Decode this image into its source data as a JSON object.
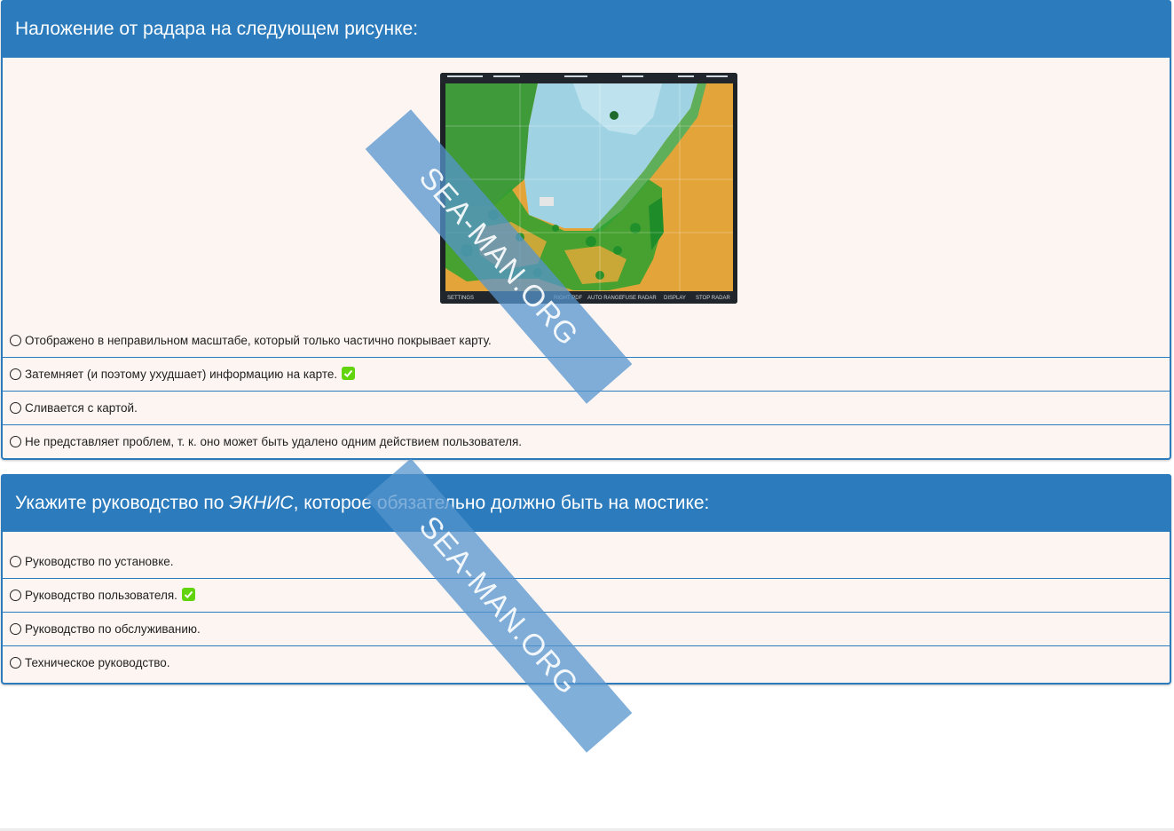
{
  "questions": [
    {
      "title": "Наложение от радара на следующем рисунке:",
      "answers": [
        {
          "text": "Отображено в неправильном масштабе, который только частично покрывает карту.",
          "correct": false
        },
        {
          "text": "Затемняет (и поэтому ухудшает) информацию на карте.",
          "correct": true
        },
        {
          "text": "Сливается с картой.",
          "correct": false
        },
        {
          "text": "Не представляет проблем, т. к. оно может быть удалено одним действием пользователя.",
          "correct": false
        }
      ]
    },
    {
      "title_before": "Укажите руководство по ",
      "title_em": "ЭКНИС",
      "title_after": ", которое обязательно должно быть на мостике:",
      "answers": [
        {
          "text": "Руководство по установке.",
          "correct": false
        },
        {
          "text": "Руководство пользователя.",
          "correct": true
        },
        {
          "text": "Руководство по обслуживанию.",
          "correct": false
        },
        {
          "text": "Техническое руководство.",
          "correct": false
        }
      ]
    }
  ],
  "radar_image": {
    "menu_labels": [
      "SETTINGS",
      "RIGHT PDF",
      "AUTO RANGE",
      "FUSE RADAR",
      "DISPLAY",
      "STOP RADAR"
    ]
  },
  "watermark": "SEA-MAN.ORG",
  "colors": {
    "header": "#2b7bbd",
    "card_bg": "#fcf5f2",
    "correct_badge": "#61d40e"
  }
}
